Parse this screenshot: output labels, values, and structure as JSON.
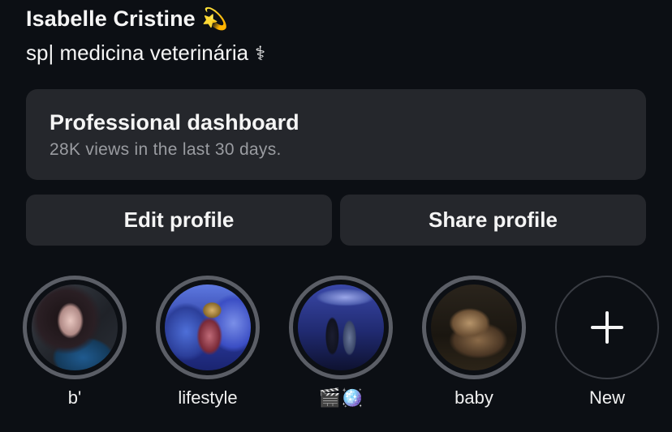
{
  "profile": {
    "name": "Isabelle Cristine",
    "name_emoji": "💫",
    "bio": "sp| medicina veterinária",
    "bio_symbol": "⚕"
  },
  "dashboard": {
    "title": "Professional dashboard",
    "subtitle": "28K views in the last 30 days."
  },
  "buttons": {
    "edit": "Edit profile",
    "share": "Share profile"
  },
  "highlights": [
    {
      "label": "b'"
    },
    {
      "label": "lifestyle"
    },
    {
      "label": "🎬🪩"
    },
    {
      "label": "baby"
    },
    {
      "label": "New"
    }
  ],
  "colors": {
    "background": "#0c0f14",
    "card": "#25272c",
    "ring": "#5b5e66",
    "muted_text": "#9a9ca1"
  }
}
